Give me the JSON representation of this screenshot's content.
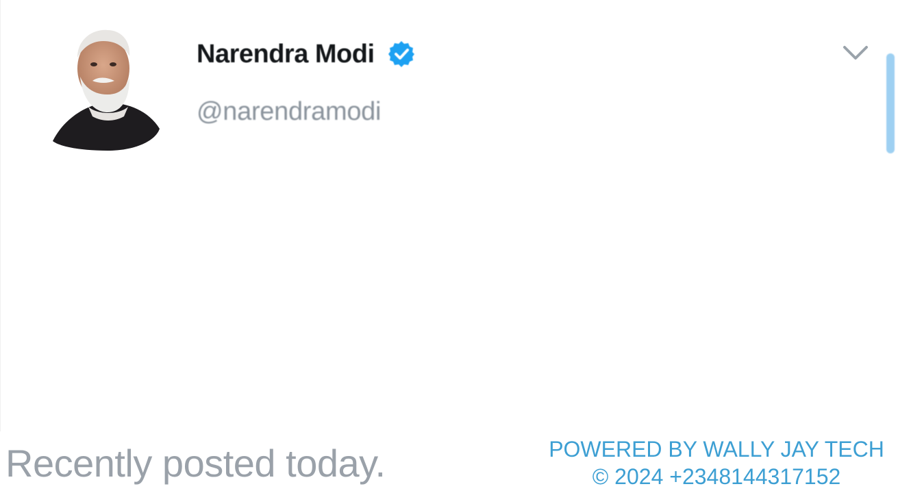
{
  "profile": {
    "name": "Narendra Modi",
    "handle": "@narendramodi",
    "verified": true,
    "verified_color": "#1da1f2"
  },
  "icons": {
    "avatar": "profile-photo",
    "verified": "verified-badge-icon",
    "menu": "chevron-down-icon"
  },
  "footer": {
    "caption": "Recently posted today.",
    "powered_by": "POWERED BY WALLY JAY TECH",
    "copyright": "© 2024 +2348144317152",
    "caption_color": "#9aa1a9",
    "credit_color": "#3d9fd3"
  }
}
